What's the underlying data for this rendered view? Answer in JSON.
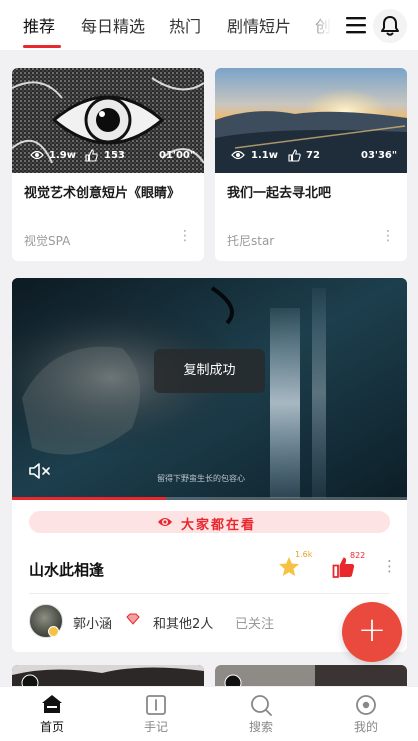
{
  "tabs": [
    {
      "label": "推荐",
      "active": true
    },
    {
      "label": "每日精选"
    },
    {
      "label": "热门"
    },
    {
      "label": "剧情短片"
    },
    {
      "label": "创意"
    }
  ],
  "icons": {
    "menu": "menu-icon",
    "bell": "bell-icon"
  },
  "cards": [
    {
      "title": "视觉艺术创意短片《眼睛》",
      "author": "视觉SPA",
      "views": "1.9w",
      "likes": "153",
      "duration": "01'00\""
    },
    {
      "title": "我们一起去寻北吧",
      "author": "托尼star",
      "views": "1.1w",
      "likes": "72",
      "duration": "03'36\""
    }
  ],
  "video": {
    "toast": "复制成功",
    "subtitle": "留得下野蛮生长的包容心",
    "progress": 0.39,
    "hot_label": "大家都在看",
    "title": "山水此相逢",
    "star_count": "1.6k",
    "like_count": "822",
    "author": "郭小涵",
    "others": "和其他2人",
    "follow_status": "已关注"
  },
  "fab": {
    "label": "+"
  },
  "bottom_nav": [
    {
      "label": "首页",
      "icon": "home-icon",
      "active": true
    },
    {
      "label": "手记",
      "icon": "notebook-icon"
    },
    {
      "label": "搜索",
      "icon": "search-icon"
    },
    {
      "label": "我的",
      "icon": "profile-icon"
    }
  ],
  "colors": {
    "accent": "#e8282d",
    "fab": "#ea4a3d",
    "hot_bg": "#fde3e3",
    "star": "#f6c243"
  }
}
